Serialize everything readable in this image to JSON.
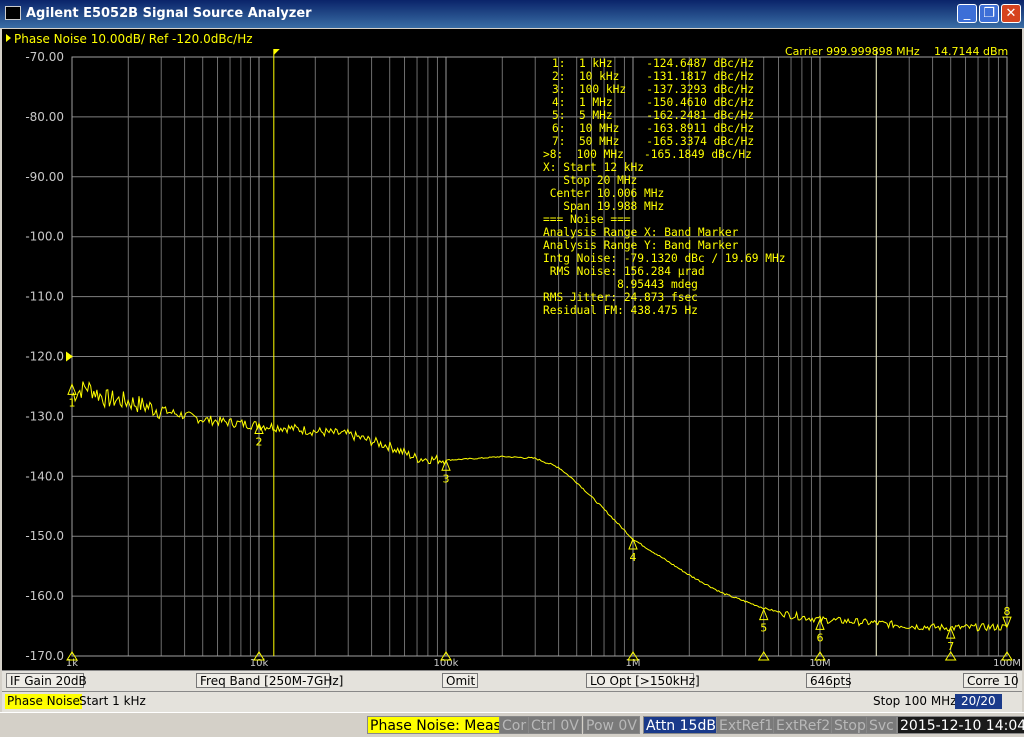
{
  "window": {
    "title": "Agilent E5052B Signal Source Analyzer",
    "minimize": "_",
    "restore": "❐",
    "close": "✕"
  },
  "trace": {
    "header": "Phase Noise 10.00dB/ Ref -120.0dBc/Hz",
    "carrier": "Carrier 999.999898 MHz",
    "power": "14.7144 dBm",
    "color": "#ffff00"
  },
  "axis": {
    "y_ticks": [
      "-70.00",
      "-80.00",
      "-90.00",
      "-100.0",
      "-110.0",
      "-120.0",
      "-130.0",
      "-140.0",
      "-150.0",
      "-160.0",
      "-170.0"
    ],
    "x_ticks": [
      "1k",
      "10k",
      "100k",
      "1M",
      "10M",
      "100M"
    ]
  },
  "markers": [
    {
      "id": "1",
      "label": "1:  1 kHz     -124.6487 dBc/Hz"
    },
    {
      "id": "2",
      "label": "2:  10 kHz    -131.1817 dBc/Hz"
    },
    {
      "id": "3",
      "label": "3:  100 kHz   -137.3293 dBc/Hz"
    },
    {
      "id": "4",
      "label": "4:  1 MHz     -150.4610 dBc/Hz"
    },
    {
      "id": "5",
      "label": "5:  5 MHz     -162.2481 dBc/Hz"
    },
    {
      "id": "6",
      "label": "6:  10 MHz    -163.8911 dBc/Hz"
    },
    {
      "id": "7",
      "label": "7:  50 MHz    -165.3374 dBc/Hz"
    },
    {
      "id": "8",
      "label": ">8:  100 MHz   -165.1849 dBc/Hz"
    }
  ],
  "info_lines": [
    "X: Start 12 kHz",
    "   Stop 20 MHz",
    " Center 10.006 MHz",
    "   Span 19.988 MHz",
    "=== Noise ===",
    "Analysis Range X: Band Marker",
    "Analysis Range Y: Band Marker",
    "Intg Noise: -79.1320 dBc / 19.69 MHz",
    " RMS Noise: 156.284 µrad",
    "           8.95443 mdeg",
    "RMS Jitter: 24.873 fsec",
    "Residual FM: 438.475 Hz"
  ],
  "chart_data": {
    "type": "line",
    "x_scale": "log",
    "xlim": [
      1000,
      100000000
    ],
    "ylim": [
      -170,
      -70
    ],
    "series": [
      {
        "x": [
          1000,
          1200,
          1500,
          2000,
          3000,
          5000,
          7000,
          10000,
          15000,
          20000,
          30000,
          50000,
          70000,
          100000,
          150000,
          200000,
          300000,
          400000,
          500000,
          700000,
          1000000,
          1500000,
          2000000,
          3000000,
          5000000,
          7000000,
          10000000,
          20000000,
          30000000,
          50000000,
          70000000,
          100000000
        ],
        "y": [
          -126.5,
          -125,
          -127,
          -127.5,
          -129,
          -130.5,
          -131,
          -131.5,
          -132,
          -132.5,
          -133,
          -135,
          -137,
          -137.3,
          -137,
          -136.7,
          -137,
          -138.5,
          -141,
          -145.5,
          -150.5,
          -154,
          -156.5,
          -159.5,
          -162,
          -163.2,
          -163.9,
          -164.5,
          -165,
          -165.3,
          -165.2,
          -165.2
        ]
      }
    ],
    "marker_points": [
      {
        "id": "1",
        "x": 1000,
        "y": -124.6487
      },
      {
        "id": "2",
        "x": 10000,
        "y": -131.1817
      },
      {
        "id": "3",
        "x": 100000,
        "y": -137.3293
      },
      {
        "id": "4",
        "x": 1000000,
        "y": -150.461
      },
      {
        "id": "5",
        "x": 5000000,
        "y": -162.2481
      },
      {
        "id": "6",
        "x": 10000000,
        "y": -163.8911
      },
      {
        "id": "7",
        "x": 50000000,
        "y": -165.3374
      },
      {
        "id": "8",
        "x": 100000000,
        "y": -165.1849
      }
    ],
    "band_marker": {
      "start": 12000,
      "stop": 20000000
    }
  },
  "softkeys": {
    "if_gain": "IF Gain 20dB",
    "freq_band": "Freq Band [250M-7GHz]",
    "omit": "Omit",
    "lo_opt": "LO Opt [>150kHz]",
    "points": "646pts",
    "corre": "Corre 10"
  },
  "sweep": {
    "meas": "Phase Noise",
    "start": "Start 1 kHz",
    "stop": "Stop 100 MHz",
    "count": "20/20"
  },
  "status": {
    "mode": "Phase Noise: Meas",
    "cor": "Cor",
    "ctrl": "Ctrl  0V",
    "pow": "Pow  0V",
    "attn": "Attn 15dB",
    "extref1": "ExtRef1",
    "extref2": "ExtRef2",
    "stop": "Stop",
    "svc": "Svc",
    "datetime": "2015-12-10 14:04"
  }
}
